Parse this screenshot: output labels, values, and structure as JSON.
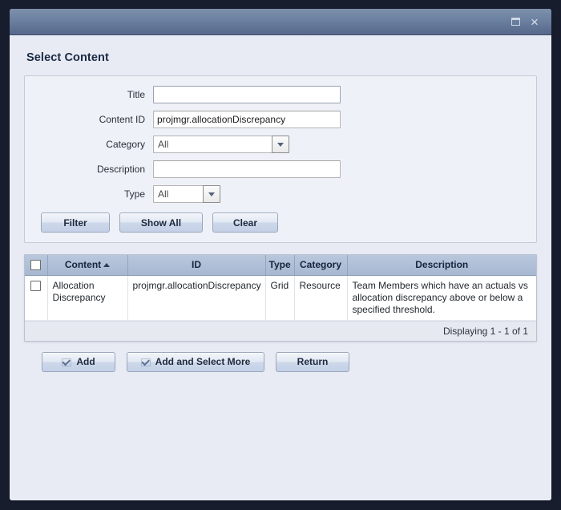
{
  "window": {
    "title": "",
    "controls": {
      "maximize_label": "Maximize",
      "close_label": "×"
    }
  },
  "dialog": {
    "page_title": "Select Content"
  },
  "filter_form": {
    "fields": [
      {
        "label": "Title",
        "value": "",
        "placeholder": "",
        "type": "text"
      },
      {
        "label": "Content ID",
        "value": "projmgr.allocationDiscrepancy",
        "placeholder": "",
        "type": "text"
      },
      {
        "label": "Category",
        "value": "All",
        "placeholder": "",
        "type": "combo"
      },
      {
        "label": "Description",
        "value": "",
        "placeholder": "",
        "type": "text"
      },
      {
        "label": "Type",
        "value": "All",
        "placeholder": "",
        "type": "combo"
      }
    ],
    "buttons": [
      {
        "label": "Filter",
        "name": "filter-button"
      },
      {
        "label": "Show All",
        "name": "show-all-button"
      },
      {
        "label": "Clear",
        "name": "clear-button"
      }
    ]
  },
  "grid": {
    "columns": [
      {
        "label": "",
        "name": "select-all-column"
      },
      {
        "label": "Content",
        "name": "content-column",
        "sorted": "asc"
      },
      {
        "label": "ID",
        "name": "id-column"
      },
      {
        "label": "Type",
        "name": "type-column"
      },
      {
        "label": "Category",
        "name": "category-column"
      },
      {
        "label": "Description",
        "name": "description-column"
      }
    ],
    "rows": [
      {
        "selected": false,
        "content": "Allocation Discrepancy",
        "id": "projmgr.allocationDiscrepancy",
        "type": "Grid",
        "category": "Resource",
        "description": "Team Members which have an actuals vs allocation discrepancy above or below a specified threshold."
      }
    ],
    "footer_status": "Displaying 1 - 1 of 1"
  },
  "action_buttons": [
    {
      "label": "Add",
      "name": "add-button",
      "icon": "check-icon"
    },
    {
      "label": "Add and Select More",
      "name": "add-and-select-more-button",
      "icon": "check-icon"
    },
    {
      "label": "Return",
      "name": "return-button",
      "icon": ""
    }
  ],
  "colors": {
    "frame": "#171d2d",
    "titlebar_top": "#7d90ab",
    "titlebar_bottom": "#57688a",
    "body": "#e8ebf3",
    "panel": "#eef1f7",
    "grid_header_top": "#b9c7dc",
    "grid_header_bottom": "#a7b8d1",
    "heading": "#1b2a45"
  }
}
